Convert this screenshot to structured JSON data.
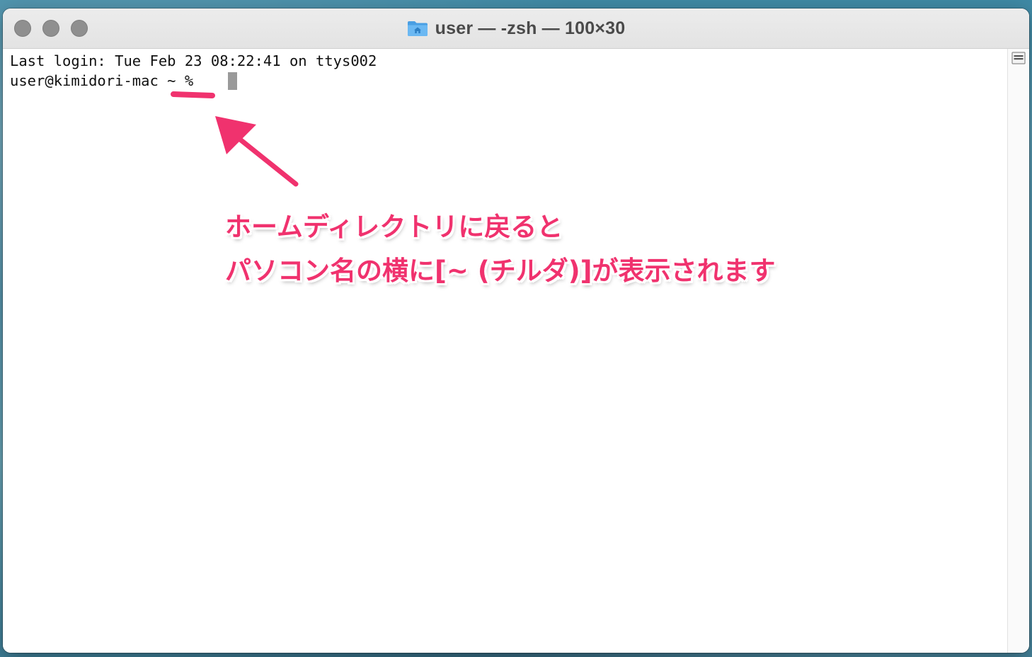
{
  "window": {
    "title": "user — -zsh — 100×30",
    "title_icon": "home-folder-icon"
  },
  "terminal": {
    "last_login": "Last login: Tue Feb 23 08:22:41 on ttys002",
    "prompt": "user@kimidori-mac ~ % "
  },
  "annotation": {
    "line1": "ホームディレクトリに戻ると",
    "line2": "パソコン名の横に[~ (チルダ)]が表示されます",
    "color": "#f0326e"
  },
  "colors": {
    "traffic_lights_inactive": "#8f8f8f",
    "cursor": "#9a9a9a",
    "folder_icon": "#5aaef0"
  }
}
